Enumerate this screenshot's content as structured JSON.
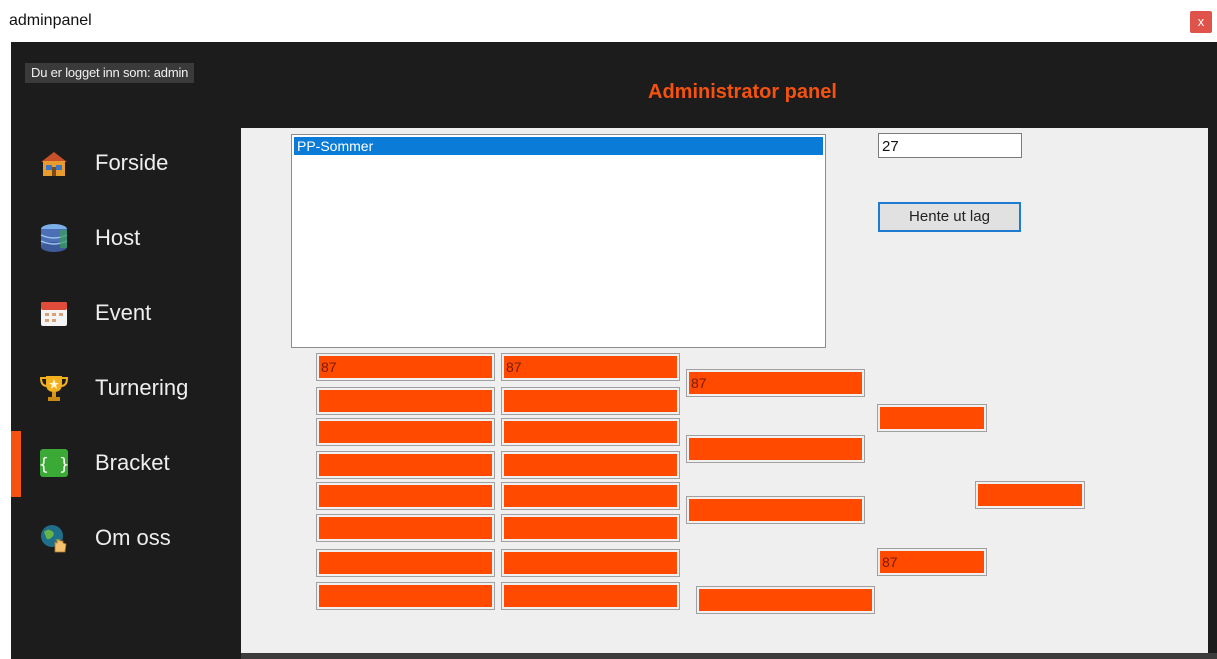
{
  "window": {
    "title": "adminpanel",
    "close_label": "x"
  },
  "header": {
    "logged_in": "Du er logget inn som: admin",
    "title": "Administrator panel"
  },
  "sidebar": {
    "items": [
      {
        "label": "Forside",
        "icon": "house-icon"
      },
      {
        "label": "Host",
        "icon": "database-icon"
      },
      {
        "label": "Event",
        "icon": "calendar-icon"
      },
      {
        "label": "Turnering",
        "icon": "trophy-icon"
      },
      {
        "label": "Bracket",
        "icon": "braces-icon",
        "active": true
      },
      {
        "label": "Om oss",
        "icon": "globe-hand-icon"
      }
    ]
  },
  "main": {
    "list": {
      "items": [
        "PP-Sommer"
      ],
      "selected": "PP-Sommer"
    },
    "number_field": "27",
    "fetch_button": "Hente ut lag",
    "bracket": {
      "round1": [
        "87",
        "",
        "",
        "",
        "",
        "",
        "",
        ""
      ],
      "round2": [
        "87",
        "",
        "",
        "",
        "",
        "",
        "",
        ""
      ],
      "round3": [
        "87",
        "",
        "",
        ""
      ],
      "round4": [
        "",
        "87"
      ],
      "final": [
        ""
      ]
    }
  },
  "colors": {
    "accent": "#f5520f",
    "selection": "#0a7bd7",
    "slot": "#ff4a00",
    "background": "#1c1c1c"
  }
}
